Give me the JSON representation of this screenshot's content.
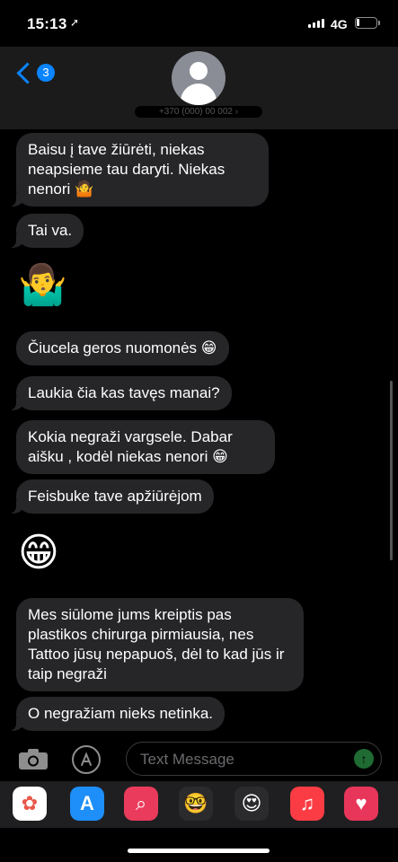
{
  "status_bar": {
    "time": "15:13",
    "network": "4G"
  },
  "header": {
    "back_badge": "3",
    "contact_name": "+370 (000) 00 002 ›"
  },
  "messages": [
    {
      "text": "Baisu į tave žiūrėti, niekas neapsieme tau daryti. Niekas nenori 🤷"
    },
    {
      "text": "Tai va."
    },
    {
      "emoji": "🤷‍♂️"
    },
    {
      "text": "Čiucela geros nuomonės 😁"
    },
    {
      "text": "Laukia čia kas tavęs manai?"
    },
    {
      "text": "Kokia negraži vargsele. Dabar aišku , kodėl niekas nenori 😁"
    },
    {
      "text": "Feisbuke tave apžiūrėjom"
    },
    {
      "emoji": "😁"
    },
    {
      "text": "Mes siūlome jums kreiptis pas plastikos chirurga pirmiausia, nes Tattoo jūsų nepapuoš, dėl to kad jūs ir taip negraži"
    },
    {
      "text": "O negražiam nieks netinka."
    }
  ],
  "composer": {
    "placeholder": "Text Message",
    "send_icon": "↑"
  },
  "app_drawer": [
    {
      "name": "photos",
      "glyph": "✿"
    },
    {
      "name": "app-store",
      "glyph": "A"
    },
    {
      "name": "search-images",
      "glyph": "⌕"
    },
    {
      "name": "memoji",
      "glyph": "🤓"
    },
    {
      "name": "memoji-stickers",
      "glyph": "😍"
    },
    {
      "name": "music",
      "glyph": "♫"
    },
    {
      "name": "digital-touch",
      "glyph": "♥"
    }
  ]
}
